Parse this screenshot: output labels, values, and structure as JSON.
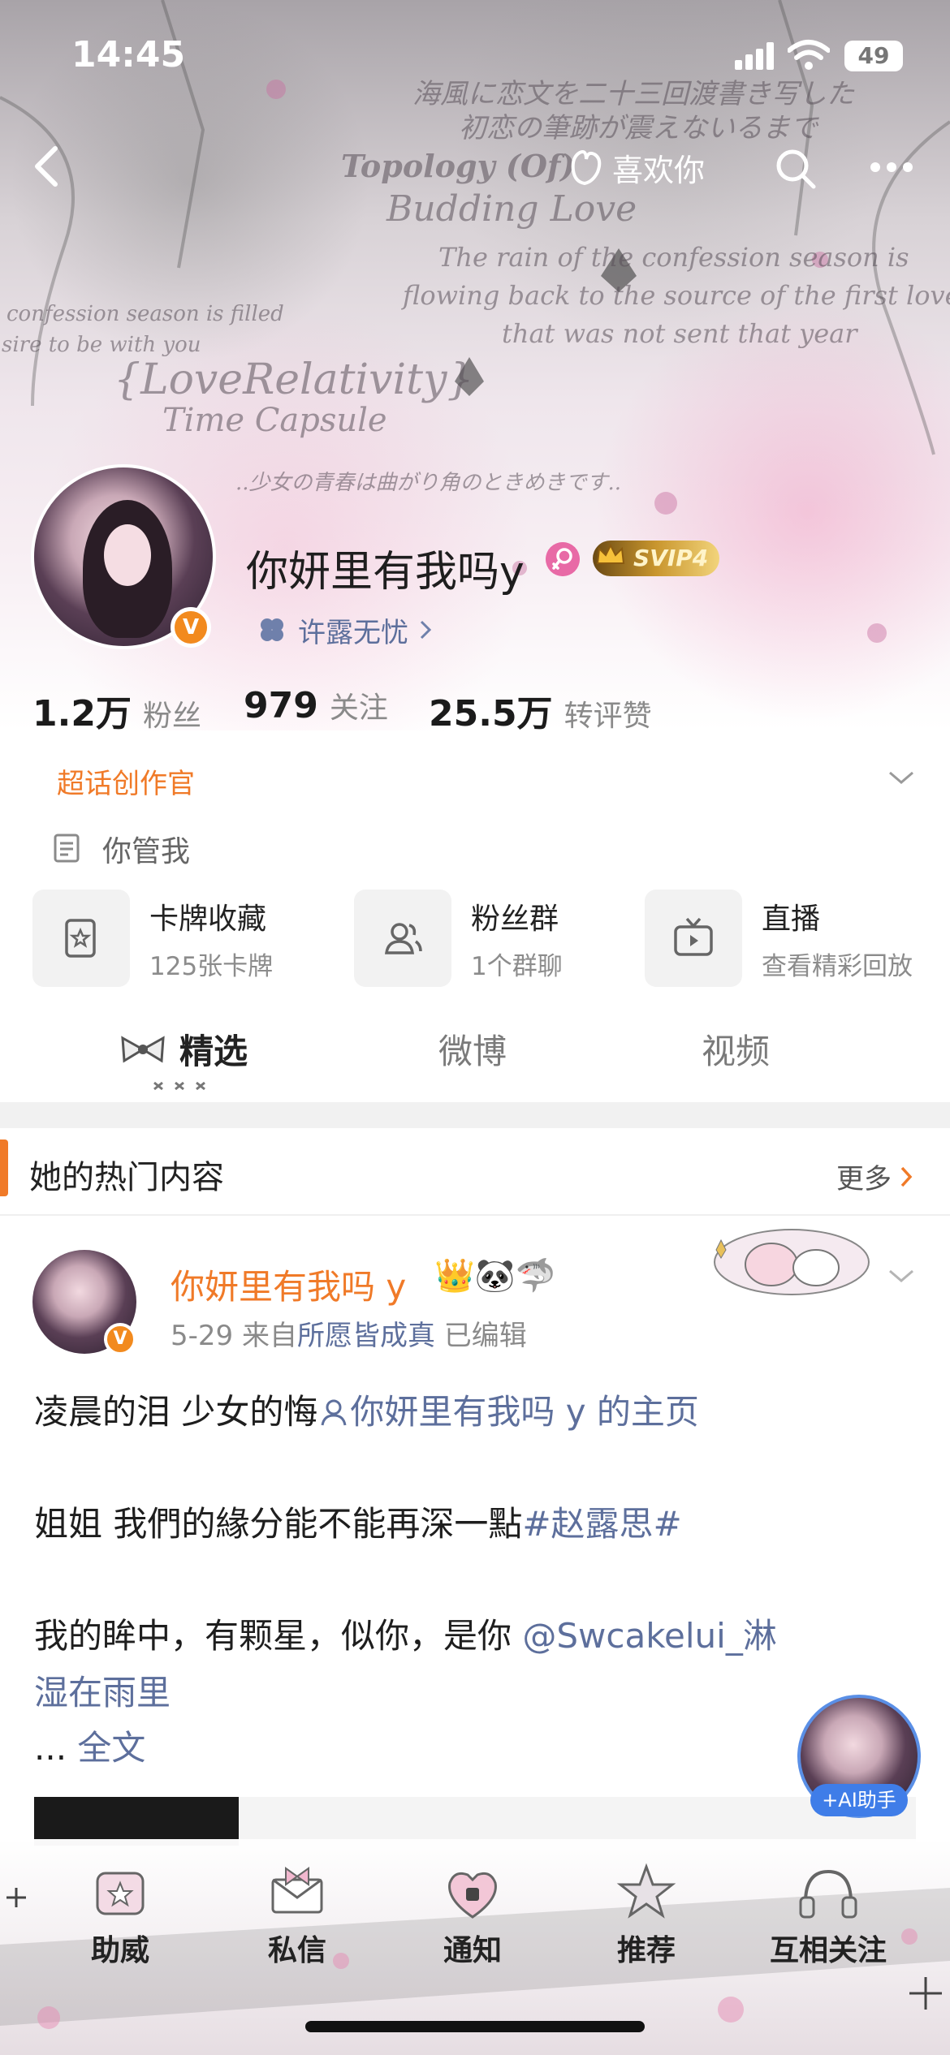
{
  "status_bar": {
    "time": "14:45",
    "battery": "49"
  },
  "banner": {
    "lines": [
      "海風に恋文を二十三回渡書き写した",
      "初恋の筆跡が震えないるまで",
      "Topology (Of)",
      "Budding Love",
      "The rain of the confession season is",
      "flowing back to the source of the first love",
      "that was not sent that year",
      "confession season is filled",
      "sire to be with you",
      "{LoveRelativity}",
      "Time Capsule",
      "..少女の青春は曲がり角のときめきです.."
    ]
  },
  "nav": {
    "like_label": "喜欢你"
  },
  "profile": {
    "name": "你妍里有我吗y",
    "svip_label": "SVIP4",
    "verified_mark": "V",
    "group_tag": "许露无忧",
    "stats": [
      {
        "num": "1.2万",
        "label": "粉丝"
      },
      {
        "num": "979",
        "label": "关注"
      },
      {
        "num": "25.5万",
        "label": "转评赞"
      }
    ],
    "role": "超话创作官",
    "bio": "你管我"
  },
  "features": [
    {
      "title": "卡牌收藏",
      "sub": "125张卡牌"
    },
    {
      "title": "粉丝群",
      "sub": "1个群聊"
    },
    {
      "title": "直播",
      "sub": "查看精彩回放"
    }
  ],
  "tabs": {
    "featured": "精选",
    "weibo": "微博",
    "video": "视频"
  },
  "hot": {
    "title": "她的热门内容",
    "more": "更多"
  },
  "post": {
    "author": "你妍里有我吗 y",
    "emojis": "👑🐼🦈",
    "date": "5-29",
    "from": "来自",
    "source": "所愿皆成真",
    "edited": "已编辑",
    "verified_mark": "V",
    "line1_text": "凌晨的泪 少女的悔",
    "line1_link": "你妍里有我吗 y 的主页",
    "line2_text": "姐姐 我們的緣分能不能再深一點",
    "line2_tag": "#赵露思#",
    "line3_text": "我的眸中，有颗星，似你，是你 ",
    "line3_link": "@Swcakelui_淋",
    "line4_link": "湿在雨里",
    "ellipsis": "... ",
    "full_text": "全文"
  },
  "ai_helper": "+AI助手",
  "bottom_nav": [
    "助威",
    "私信",
    "通知",
    "推荐",
    "互相关注"
  ],
  "colors": {
    "accent_orange": "#f07a28",
    "link_blue": "#5d6f9c",
    "svip_gold": "#c9962e",
    "ai_blue": "#3f7de8"
  }
}
